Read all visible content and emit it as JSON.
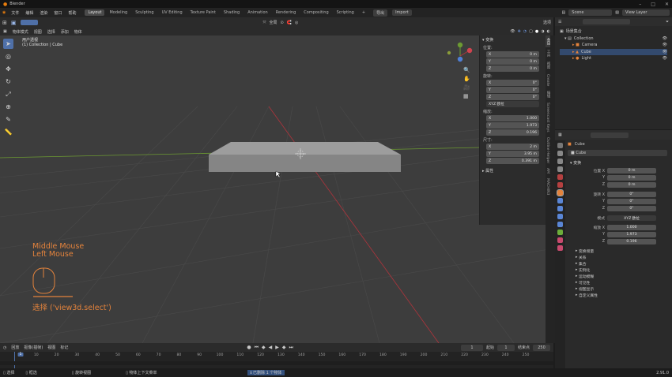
{
  "window": {
    "title": "Blender"
  },
  "menu": [
    "文件",
    "编辑",
    "渲染",
    "窗口",
    "帮助"
  ],
  "workspaces": [
    {
      "label": "Layout",
      "active": true
    },
    {
      "label": "Modeling",
      "active": false
    },
    {
      "label": "Sculpting",
      "active": false
    },
    {
      "label": "UV Editing",
      "active": false
    },
    {
      "label": "Texture Paint",
      "active": false
    },
    {
      "label": "Shading",
      "active": false
    },
    {
      "label": "Animation",
      "active": false
    },
    {
      "label": "Rendering",
      "active": false
    },
    {
      "label": "Compositing",
      "active": false
    },
    {
      "label": "Scripting",
      "active": false
    }
  ],
  "topbar": {
    "add_tab": "+",
    "export": "导出",
    "import": "Import",
    "scene": "Scene",
    "view_layer": "View Layer"
  },
  "viewport": {
    "mode": "物体模式",
    "menus": [
      "视图",
      "选择",
      "添加",
      "物体"
    ],
    "orientation": "全局",
    "view_name": "用户透视",
    "collection_label": "(1) Collection | Cube",
    "overlay_mouse_1": "Middle Mouse",
    "overlay_mouse_2": "Left Mouse",
    "overlay_operator": "选择 ('view3d.select')",
    "options": "选项"
  },
  "npanel": {
    "section": "变换",
    "location_label": "位置:",
    "location": [
      {
        "axis": "X",
        "value": "0 m"
      },
      {
        "axis": "Y",
        "value": "0 m"
      },
      {
        "axis": "Z",
        "value": "0 m"
      }
    ],
    "rotation_label": "旋转:",
    "rotation": [
      {
        "axis": "X",
        "value": "0°"
      },
      {
        "axis": "Y",
        "value": "0°"
      },
      {
        "axis": "Z",
        "value": "0°"
      }
    ],
    "rotation_mode": "XYZ 欧拉",
    "scale_label": "缩放:",
    "scale": [
      {
        "axis": "X",
        "value": "1.000"
      },
      {
        "axis": "Y",
        "value": "1.973"
      },
      {
        "axis": "Z",
        "value": "0.196"
      }
    ],
    "dimensions_label": "尺寸:",
    "dimensions": [
      {
        "axis": "X",
        "value": "2 m"
      },
      {
        "axis": "Y",
        "value": "3.95 m"
      },
      {
        "axis": "Z",
        "value": "0.391 m"
      }
    ],
    "properties_section": "属性"
  },
  "side_tabs": [
    "条目",
    "工具",
    "视图",
    "Create",
    "编辑",
    "Screencast Keys",
    "Outline Helper",
    "AM",
    "MACHIN3"
  ],
  "outliner": {
    "title": "场景集合",
    "collection": "Collection",
    "items": [
      "Camera",
      "Cube",
      "Light"
    ]
  },
  "properties": {
    "object_name": "Cube",
    "object_field": "Cube",
    "section": "变换",
    "location_label": "位置 X",
    "location": [
      "0 m",
      "0 m",
      "0 m"
    ],
    "rotation_label": "旋转 X",
    "rotation": [
      "0°",
      "0°",
      "0°"
    ],
    "mode_label": "模式",
    "mode_value": "XYZ 欧拉",
    "scale_label": "缩放 X",
    "scale": [
      "1.000",
      "1.973",
      "0.196"
    ],
    "delta": "变换增量",
    "panels": [
      "关系",
      "集合",
      "实例化",
      "运动模糊",
      "可见性",
      "视图显示",
      "自定义属性"
    ],
    "axis_y": "Y",
    "axis_z": "Z"
  },
  "timeline": {
    "menus": [
      "回放",
      "抠像(插帧)",
      "视图",
      "标记"
    ],
    "current_frame": "1",
    "start_label": "起始",
    "start": "1",
    "end_label": "结束点",
    "end": "250",
    "ticks": [
      "0",
      "10",
      "20",
      "30",
      "40",
      "50",
      "60",
      "70",
      "80",
      "90",
      "100",
      "110",
      "120",
      "130",
      "140",
      "150",
      "160",
      "170",
      "180",
      "190",
      "200",
      "210",
      "220",
      "230",
      "240",
      "250"
    ]
  },
  "status": {
    "select": "选择",
    "box_select": "框选",
    "rotate_view": "旋转视图",
    "context_menu": "物体上下文菜单",
    "info": "已删除 1 个物体",
    "version": "2.91.0"
  },
  "colors": {
    "accent": "#4f70a8",
    "overlay_text": "#e4833c",
    "x_axis": "#b0343c",
    "y_axis": "#6c9a32"
  }
}
